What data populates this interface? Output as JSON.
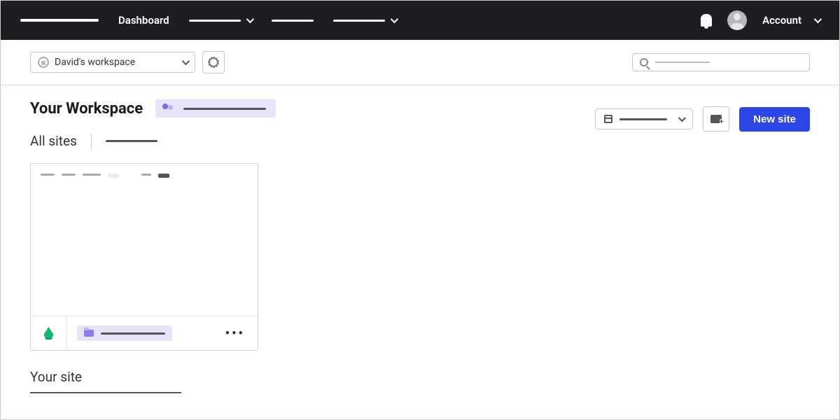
{
  "nav": {
    "logo_alt": "Brand",
    "items": [
      {
        "label": "Dashboard",
        "active": true
      },
      {
        "label": "",
        "placeholder_width": 74,
        "has_caret": true
      },
      {
        "label": "",
        "placeholder_width": 60,
        "has_caret": false
      },
      {
        "label": "",
        "placeholder_width": 74,
        "has_caret": true
      }
    ],
    "account_label": "Account"
  },
  "subbar": {
    "workspace_name": "David's workspace",
    "search_placeholder": "Search"
  },
  "workspace": {
    "title": "Your Workspace",
    "team_chip_width": 118,
    "all_sites_label": "All sites",
    "all_sites_sub_width": 74,
    "date_range_width": 68,
    "new_site_label": "New site",
    "card": {
      "preview_item_widths": [
        20,
        20,
        26
      ],
      "preview_chip1_width": 30,
      "preview_mid_width": 14,
      "preview_chip2_width": 30,
      "site_name_width": 92
    },
    "your_site_label": "Your site"
  },
  "colors": {
    "accent": "#2c46e8",
    "soft_accent": "#e6e3fb",
    "green": "#11b86d"
  }
}
